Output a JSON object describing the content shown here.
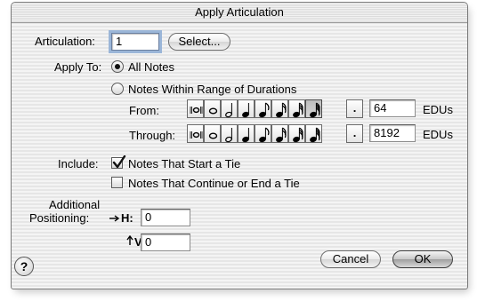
{
  "window": {
    "title": "Apply Articulation"
  },
  "articulation": {
    "label": "Articulation:",
    "value": "1",
    "select_button": "Select..."
  },
  "apply_to": {
    "label": "Apply To:",
    "all_notes": "All Notes",
    "range_option": "Notes Within Range of Durations",
    "selected": "all_notes"
  },
  "from": {
    "label": "From:",
    "value": "64",
    "unit": "EDUs",
    "selected_tool": 7,
    "tools": [
      "breve-icon",
      "whole-note-icon",
      "half-note-icon",
      "quarter-note-icon",
      "eighth-note-icon",
      "sixteenth-note-icon",
      "thirty-second-note-icon",
      "sixty-fourth-note-icon"
    ],
    "dot_label": "."
  },
  "through": {
    "label": "Through:",
    "value": "8192",
    "unit": "EDUs",
    "selected_tool": -1,
    "tools": [
      "breve-icon",
      "whole-note-icon",
      "half-note-icon",
      "quarter-note-icon",
      "eighth-note-icon",
      "sixteenth-note-icon",
      "thirty-second-note-icon",
      "sixty-fourth-note-icon"
    ],
    "dot_label": "."
  },
  "include": {
    "label": "Include:",
    "start_tie": {
      "label": "Notes That Start a Tie",
      "checked": true
    },
    "continue_tie": {
      "label": "Notes That Continue or End a Tie",
      "checked": false
    }
  },
  "positioning": {
    "label_line1": "Additional",
    "label_line2": "Positioning:",
    "h_label": "H:",
    "h_value": "0",
    "v_label": "V:",
    "v_value": "0"
  },
  "buttons": {
    "cancel": "Cancel",
    "ok": "OK",
    "help": "?"
  }
}
